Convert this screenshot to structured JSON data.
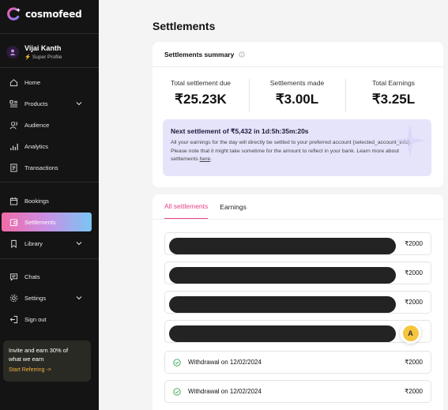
{
  "brand": {
    "name": "cosmofeed"
  },
  "profile": {
    "name": "Vijai Kanth",
    "role": "Super Profile"
  },
  "nav": {
    "home": "Home",
    "products": "Products",
    "audience": "Audience",
    "analytics": "Analytics",
    "transactions": "Transactions",
    "bookings": "Bookings",
    "settlements": "Settlements",
    "library": "Library",
    "chats": "Chats",
    "settings": "Settings",
    "signout": "Sign out"
  },
  "refer": {
    "text": "Invite and earn 30% of what we earn",
    "link": "Start Referring ->"
  },
  "page": {
    "title": "Settlements"
  },
  "summary": {
    "heading": "Settlements summary",
    "stats": [
      {
        "label": "Total settlement due",
        "value": "₹25.23K"
      },
      {
        "label": "Settlements made",
        "value": "₹3.00L"
      },
      {
        "label": "Total Earnings",
        "value": "₹3.25L"
      }
    ],
    "next": {
      "title": "Next settlement of ₹5,432 in 1d:5h:35m:20s",
      "desc": "All your earnings for the day will directly be settled to your preferred account {selected_account_info}. Please note that it might take sometime for the amount to reflect in your bank. Learn more about settlements",
      "link": "here",
      "end": "."
    }
  },
  "tabs": {
    "all": "All settlements",
    "earnings": "Earnings"
  },
  "rows": [
    {
      "label": "",
      "amount": "₹2000"
    },
    {
      "label": "",
      "amount": "₹2000"
    },
    {
      "label": "",
      "amount": "₹2000"
    },
    {
      "label": "",
      "amount": ""
    },
    {
      "label": "Withdrawal on 12/02/2024",
      "amount": "₹2000"
    },
    {
      "label": "Withdrawal on 12/02/2024",
      "amount": "₹2000"
    }
  ],
  "fab": {
    "letter": "A"
  },
  "colors": {
    "accent": "#e8408a",
    "sidebar": "#141414",
    "refer_link": "#f2b23e",
    "success": "#37a150"
  }
}
